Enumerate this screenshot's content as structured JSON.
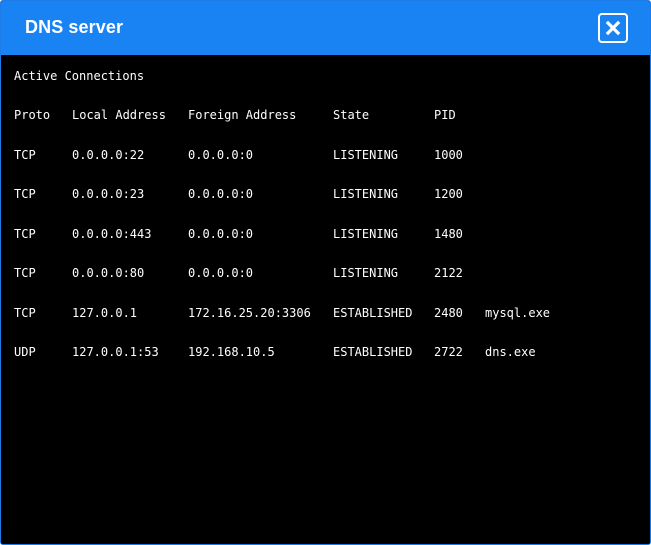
{
  "window": {
    "title": "DNS server",
    "close_icon": "close-icon"
  },
  "colors": {
    "titlebar": "#1a83f3",
    "terminal_bg": "#000000",
    "text": "#ffffff"
  },
  "terminal": {
    "heading": "Active Connections",
    "headers": {
      "proto": "Proto",
      "local": "Local Address",
      "foreign": "Foreign Address",
      "state": "State",
      "pid": "PID"
    },
    "rows": [
      {
        "proto": "TCP",
        "local": "0.0.0.0:22",
        "foreign": "0.0.0.0:0",
        "state": "LISTENING",
        "pid": "1000",
        "process": ""
      },
      {
        "proto": "TCP",
        "local": "0.0.0.0:23",
        "foreign": "0.0.0.0:0",
        "state": "LISTENING",
        "pid": "1200",
        "process": ""
      },
      {
        "proto": "TCP",
        "local": "0.0.0.0:443",
        "foreign": "0.0.0.0:0",
        "state": "LISTENING",
        "pid": "1480",
        "process": ""
      },
      {
        "proto": "TCP",
        "local": "0.0.0.0:80",
        "foreign": "0.0.0.0:0",
        "state": "LISTENING",
        "pid": "2122",
        "process": ""
      },
      {
        "proto": "TCP",
        "local": "127.0.0.1",
        "foreign": "172.16.25.20:3306",
        "state": "ESTABLISHED",
        "pid": "2480",
        "process": "mysql.exe"
      },
      {
        "proto": "UDP",
        "local": "127.0.0.1:53",
        "foreign": "192.168.10.5",
        "state": "ESTABLISHED",
        "pid": "2722",
        "process": "dns.exe"
      }
    ]
  }
}
